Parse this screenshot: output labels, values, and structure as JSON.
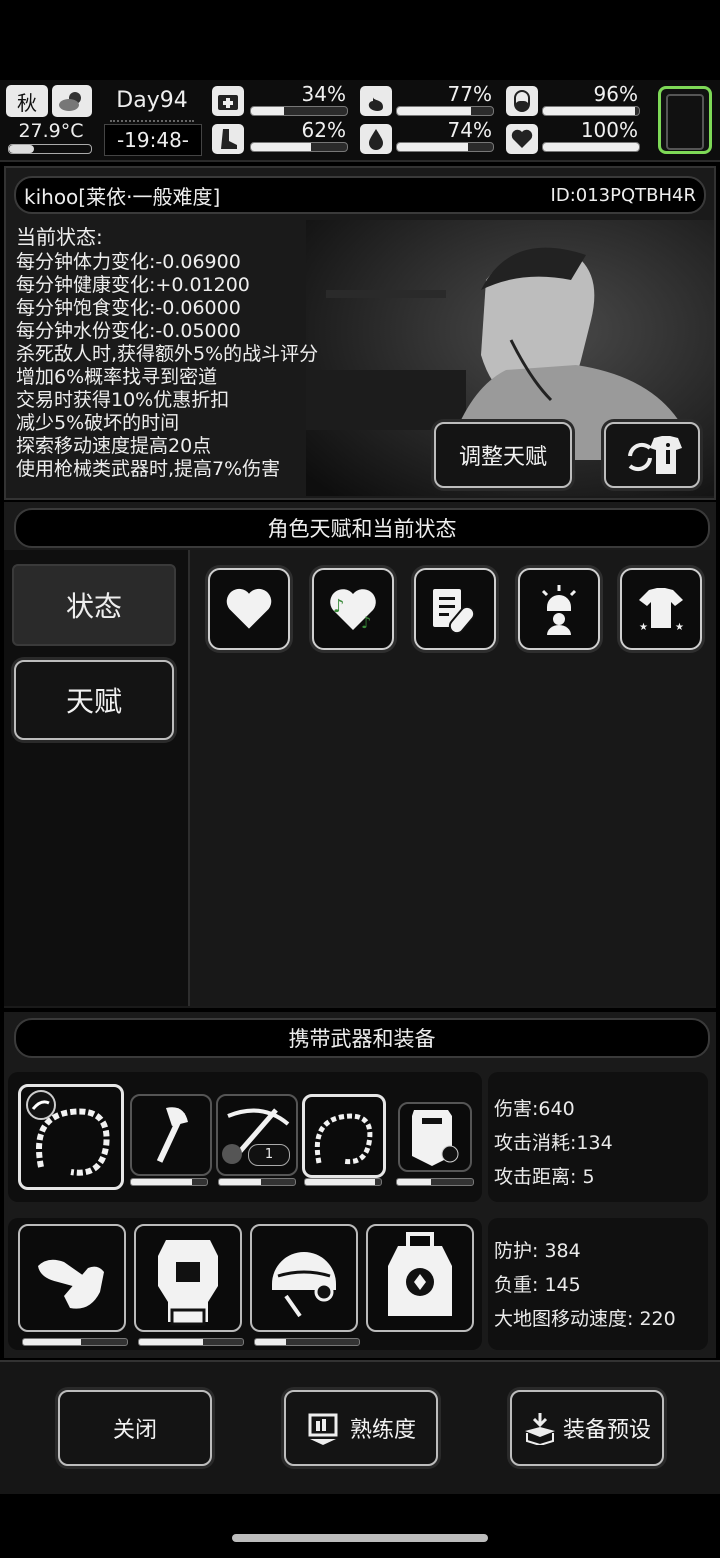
{
  "topbar": {
    "season": "秋",
    "temperature": "27.9°C",
    "day": "Day94",
    "time": "-19:48-",
    "stats": [
      {
        "icon": "first-aid-icon",
        "value": "34%",
        "fill": 0.34
      },
      {
        "icon": "stomach-icon",
        "value": "77%",
        "fill": 0.77
      },
      {
        "icon": "pill-capsule-icon",
        "value": "96%",
        "fill": 0.96
      },
      {
        "icon": "boot-icon",
        "value": "62%",
        "fill": 0.62
      },
      {
        "icon": "water-drop-icon",
        "value": "74%",
        "fill": 0.74
      },
      {
        "icon": "heart-icon",
        "value": "100%",
        "fill": 1.0
      }
    ]
  },
  "profile": {
    "name": "kihoo[莱依·一般难度]",
    "id": "ID:013PQTBH4R"
  },
  "status": {
    "heading": "当前状态:",
    "lines": [
      "每分钟体力变化:-0.06900",
      "每分钟健康变化:+0.01200",
      "每分钟饱食变化:-0.06000",
      "每分钟水份变化:-0.05000",
      "杀死敌人时,获得额外5%的战斗评分",
      "增加6%概率找寻到密道",
      "交易时获得10%优惠折扣",
      "减少5%破坏的时间",
      "探索移动速度提高20点",
      "使用枪械类武器时,提高7%伤害"
    ],
    "adjust_talent": "调整天赋"
  },
  "talent_section": {
    "title": "角色天赋和当前状态",
    "tabs": [
      "状态",
      "天赋"
    ],
    "icons": [
      "heart-icon",
      "music-heart-icon",
      "medical-clipboard-icon",
      "alarm-person-icon",
      "shirt-icon"
    ]
  },
  "equipment": {
    "title": "携带武器和装备",
    "weapons": [
      {
        "icon": "thorn-whip-icon",
        "durability": 0.8
      },
      {
        "icon": "axe-icon",
        "durability": 0.62
      },
      {
        "icon": "crossbow-icon",
        "durability": 0.55,
        "count": "1"
      },
      {
        "icon": "thorn-whip-icon",
        "durability": 0.92
      },
      {
        "icon": "riot-shield-icon",
        "durability": 0.45
      }
    ],
    "weapon_stats": [
      "伤害:640",
      "攻击消耗:134",
      "攻击距离: 5"
    ],
    "armor": [
      {
        "icon": "gloves-icon",
        "durability": 0.56
      },
      {
        "icon": "body-armor-icon",
        "durability": 0.62
      },
      {
        "icon": "helmet-icon",
        "durability": 0.3
      },
      {
        "icon": "backpack-icon",
        "durability": 0
      }
    ],
    "armor_stats": [
      "防护: 384",
      "负重: 145",
      "大地图移动速度: 220"
    ]
  },
  "footer": {
    "close": "关闭",
    "proficiency": "熟练度",
    "preset": "装备预设"
  },
  "colors": {
    "accent_green": "#7ed957"
  }
}
